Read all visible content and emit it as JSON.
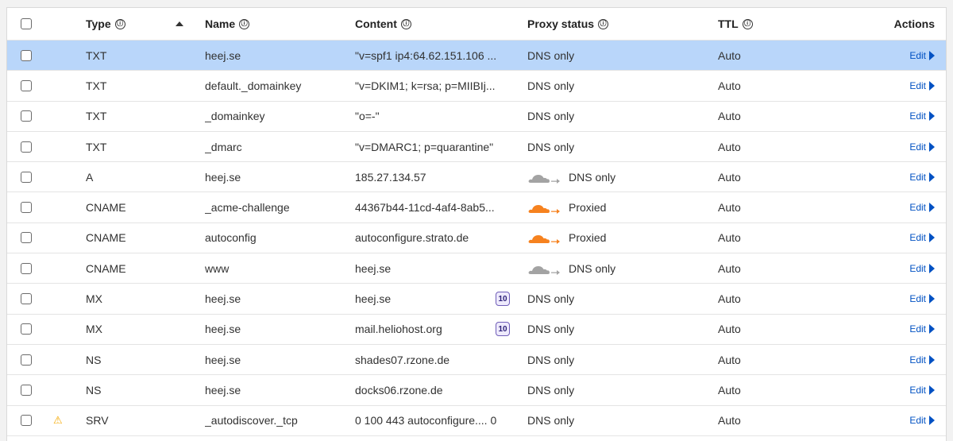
{
  "header": {
    "type": "Type",
    "name": "Name",
    "content": "Content",
    "proxy_status": "Proxy status",
    "ttl": "TTL",
    "actions": "Actions",
    "info_glyph": "ⓘ"
  },
  "edit_label": "Edit",
  "warning_glyph": "⚠",
  "colors": {
    "selected_row": "#b9d6fa",
    "proxied_cloud": "#f6821f",
    "dns_only_cloud": "#a3a3a3",
    "link": "#0051c3"
  },
  "records": [
    {
      "type": "TXT",
      "name": "heej.se",
      "content": "\"v=spf1 ip4:64.62.151.106 ...",
      "priority": "",
      "proxy": "DNS only",
      "proxy_icon": "",
      "ttl": "Auto",
      "selected": true,
      "warning": false
    },
    {
      "type": "TXT",
      "name": "default._domainkey",
      "content": "\"v=DKIM1; k=rsa; p=MIIBIj...",
      "priority": "",
      "proxy": "DNS only",
      "proxy_icon": "",
      "ttl": "Auto",
      "selected": false,
      "warning": false
    },
    {
      "type": "TXT",
      "name": "_domainkey",
      "content": "\"o=-\"",
      "priority": "",
      "proxy": "DNS only",
      "proxy_icon": "",
      "ttl": "Auto",
      "selected": false,
      "warning": false
    },
    {
      "type": "TXT",
      "name": "_dmarc",
      "content": "\"v=DMARC1; p=quarantine\"",
      "priority": "",
      "proxy": "DNS only",
      "proxy_icon": "",
      "ttl": "Auto",
      "selected": false,
      "warning": false
    },
    {
      "type": "A",
      "name": "heej.se",
      "content": "185.27.134.57",
      "priority": "",
      "proxy": "DNS only",
      "proxy_icon": "dns-only-cloud-icon",
      "ttl": "Auto",
      "selected": false,
      "warning": false
    },
    {
      "type": "CNAME",
      "name": "_acme-challenge",
      "content": "44367b44-11cd-4af4-8ab5...",
      "priority": "",
      "proxy": "Proxied",
      "proxy_icon": "proxied-cloud-icon",
      "ttl": "Auto",
      "selected": false,
      "warning": false
    },
    {
      "type": "CNAME",
      "name": "autoconfig",
      "content": "autoconfigure.strato.de",
      "priority": "",
      "proxy": "Proxied",
      "proxy_icon": "proxied-cloud-icon",
      "ttl": "Auto",
      "selected": false,
      "warning": false
    },
    {
      "type": "CNAME",
      "name": "www",
      "content": "heej.se",
      "priority": "",
      "proxy": "DNS only",
      "proxy_icon": "dns-only-cloud-icon",
      "ttl": "Auto",
      "selected": false,
      "warning": false
    },
    {
      "type": "MX",
      "name": "heej.se",
      "content": "heej.se",
      "priority": "10",
      "proxy": "DNS only",
      "proxy_icon": "",
      "ttl": "Auto",
      "selected": false,
      "warning": false
    },
    {
      "type": "MX",
      "name": "heej.se",
      "content": "mail.heliohost.org",
      "priority": "10",
      "proxy": "DNS only",
      "proxy_icon": "",
      "ttl": "Auto",
      "selected": false,
      "warning": false
    },
    {
      "type": "NS",
      "name": "heej.se",
      "content": "shades07.rzone.de",
      "priority": "",
      "proxy": "DNS only",
      "proxy_icon": "",
      "ttl": "Auto",
      "selected": false,
      "warning": false
    },
    {
      "type": "NS",
      "name": "heej.se",
      "content": "docks06.rzone.de",
      "priority": "",
      "proxy": "DNS only",
      "proxy_icon": "",
      "ttl": "Auto",
      "selected": false,
      "warning": false
    },
    {
      "type": "SRV",
      "name": "_autodiscover._tcp",
      "content": "0 100 443 autoconfigure.... 0",
      "priority": "",
      "proxy": "DNS only",
      "proxy_icon": "",
      "ttl": "Auto",
      "selected": false,
      "warning": true
    }
  ]
}
